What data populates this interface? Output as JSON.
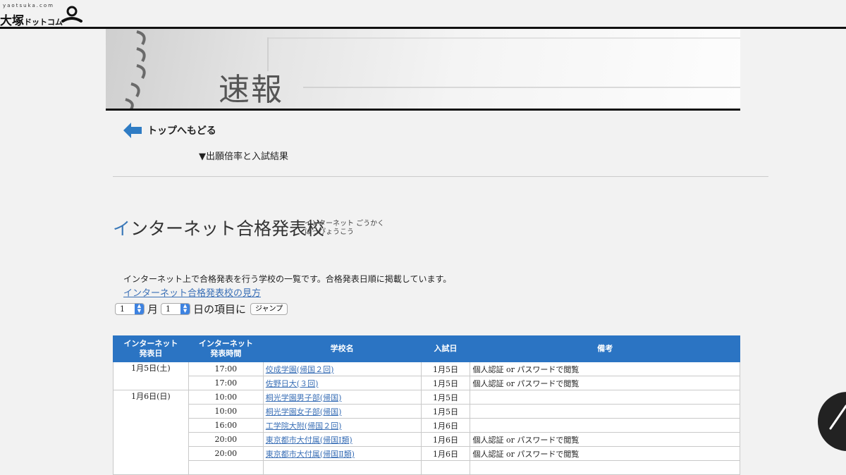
{
  "header": {
    "logo_small": "yaotsuka.com",
    "logo_main": "大塚",
    "logo_sub": "ドットコム"
  },
  "banner": {
    "title": "速報"
  },
  "nav": {
    "back_label": "トップへもどる",
    "anchor_link": "▼出願倍率と入試結果"
  },
  "section": {
    "title_first": "イ",
    "title_rest": "ンターネット合格発表校",
    "ruby_line1": "インターネット ごうかく",
    "ruby_line2": "はっぴょうこう",
    "description": "インターネット上で合格発表を行う学校の一覧です。合格発表日順に掲載しています。",
    "howto_link": "インターネット合格発表校の見方"
  },
  "jump": {
    "month_value": "1",
    "month_label": "月",
    "day_value": "1",
    "day_label": "日の項目に",
    "button_label": "ジャンプ"
  },
  "table": {
    "headers": [
      "インターネット\n発表日",
      "インターネット\n発表時間",
      "学校名",
      "入試日",
      "備考"
    ],
    "groups": [
      {
        "date": "1月5日(土)",
        "rows": [
          {
            "time": "17:00",
            "school": "佼成学園(帰国２回)",
            "exam": "1月5日",
            "note": "個人認証 or パスワードで閲覧"
          },
          {
            "time": "17:00",
            "school": "佐野日大(３回)",
            "exam": "1月5日",
            "note": "個人認証 or パスワードで閲覧"
          }
        ]
      },
      {
        "date": "1月6日(日)",
        "rows": [
          {
            "time": "10:00",
            "school": "桐光学園男子部(帰国)",
            "exam": "1月5日",
            "note": ""
          },
          {
            "time": "10:00",
            "school": "桐光学園女子部(帰国)",
            "exam": "1月5日",
            "note": ""
          },
          {
            "time": "16:00",
            "school": "工学院大附(帰国２回)",
            "exam": "1月6日",
            "note": ""
          },
          {
            "time": "20:00",
            "school": "東京都市大付属(帰国Ⅰ類)",
            "exam": "1月6日",
            "note": "個人認証 or パスワードで閲覧"
          },
          {
            "time": "20:00",
            "school": "東京都市大付属(帰国Ⅱ類)",
            "exam": "1月6日",
            "note": "個人認証 or パスワードで閲覧"
          }
        ]
      }
    ]
  },
  "colors": {
    "header_blue": "#2b74c3",
    "link_blue": "#3a6fb6",
    "back_arrow": "#2f7cc4"
  }
}
